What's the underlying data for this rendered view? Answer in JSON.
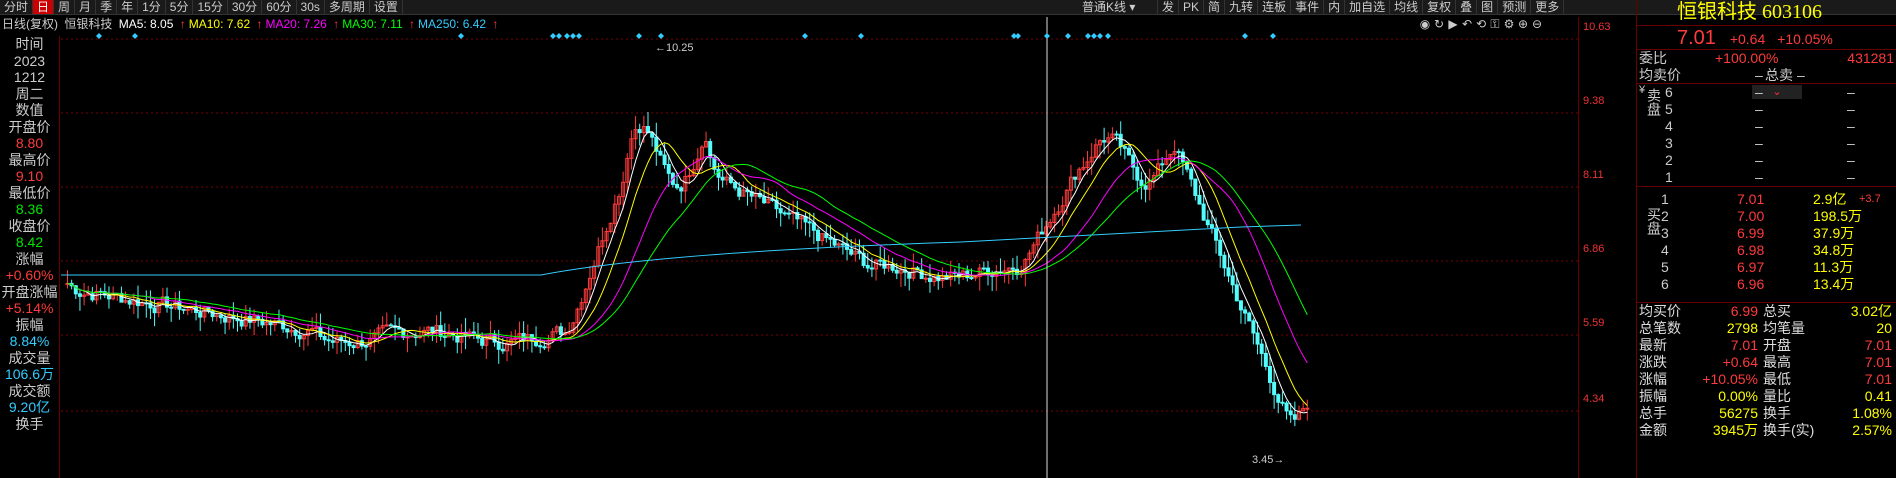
{
  "toolbar": {
    "left_items": [
      "分时",
      "日",
      "周",
      "月",
      "季",
      "年",
      "1分",
      "5分",
      "15分",
      "30分",
      "60分",
      "30s",
      "多周期",
      "设置"
    ],
    "active_index": 1,
    "kline_select": "普通K线",
    "right_items": [
      "发",
      "PK",
      "简",
      "九转",
      "连板",
      "事件",
      "内",
      "加自选",
      "均线",
      "复权",
      "叠",
      "图",
      "预测",
      "更多"
    ]
  },
  "ma_header": {
    "prefix": "日线(复权)",
    "stock": "恒银科技",
    "ma5": "MA5: 8.05",
    "ma10": "MA10: 7.62",
    "ma20": "MA20: 7.26",
    "ma30": "MA30: 7.11",
    "ma250": "MA250: 6.42"
  },
  "left_panel": [
    {
      "label": "时间",
      "value": "2023",
      "color": "#ccc"
    },
    {
      "label": "",
      "value": "1212",
      "color": "#ccc"
    },
    {
      "label": "",
      "value": "周二",
      "color": "#ccc"
    },
    {
      "label": "数值",
      "value": "",
      "color": "#ccc"
    },
    {
      "label": "开盘价",
      "value": "8.80",
      "color": "#ff3b3b"
    },
    {
      "label": "最高价",
      "value": "9.10",
      "color": "#ff3b3b"
    },
    {
      "label": "最低价",
      "value": "8.36",
      "color": "#00e600"
    },
    {
      "label": "收盘价",
      "value": "8.42",
      "color": "#00e600"
    },
    {
      "label": "涨幅",
      "value": "+0.60%",
      "color": "#ff3b3b"
    },
    {
      "label": "开盘涨幅",
      "value": "+5.14%",
      "color": "#ff3b3b"
    },
    {
      "label": "振幅",
      "value": "8.84%",
      "color": "#3cf"
    },
    {
      "label": "成交量",
      "value": "106.6万",
      "color": "#3cf"
    },
    {
      "label": "成交额",
      "value": "9.20亿",
      "color": "#3cf"
    },
    {
      "label": "换手",
      "value": "",
      "color": "#ccc"
    }
  ],
  "price_axis": [
    "10.63",
    "9.38",
    "8.11",
    "6.86",
    "5.59",
    "4.34"
  ],
  "annotations": {
    "high": "10.25",
    "low": "3.45"
  },
  "quote": {
    "name": "恒银科技",
    "code": "603106",
    "price": "7.01",
    "change": "+0.64",
    "change_pct": "+10.05%",
    "weibi_label": "委比",
    "weibi": "+100.00%",
    "weicha": "431281",
    "avg_sell_label": "均卖价",
    "total_sell_label": "总卖",
    "sell_side_label": "卖盘",
    "buy_side_label": "买盘",
    "sell_levels": [
      "6",
      "5",
      "4",
      "3",
      "2",
      "1"
    ],
    "sell_price": "–",
    "buy_levels": [
      {
        "lvl": "1",
        "price": "7.01",
        "vol": "2.9亿",
        "extra": "+3.7"
      },
      {
        "lvl": "2",
        "price": "7.00",
        "vol": "198.5万",
        "extra": ""
      },
      {
        "lvl": "3",
        "price": "6.99",
        "vol": "37.9万",
        "extra": ""
      },
      {
        "lvl": "4",
        "price": "6.98",
        "vol": "34.8万",
        "extra": ""
      },
      {
        "lvl": "5",
        "price": "6.97",
        "vol": "11.3万",
        "extra": ""
      },
      {
        "lvl": "6",
        "price": "6.96",
        "vol": "13.4万",
        "extra": ""
      }
    ],
    "stats": [
      {
        "l": "均买价",
        "v": "6.99",
        "l2": "总买",
        "v2": "3.02亿",
        "c": "#ff3b3b",
        "c2": "#ff0"
      },
      {
        "l": "总笔数",
        "v": "2798",
        "l2": "均笔量",
        "v2": "20",
        "c": "#ff0",
        "c2": "#ff0"
      },
      {
        "l": "最新",
        "v": "7.01",
        "l2": "开盘",
        "v2": "7.01",
        "c": "#ff3b3b",
        "c2": "#ff3b3b"
      },
      {
        "l": "涨跌",
        "v": "+0.64",
        "l2": "最高",
        "v2": "7.01",
        "c": "#ff3b3b",
        "c2": "#ff3b3b"
      },
      {
        "l": "涨幅",
        "v": "+10.05%",
        "l2": "最低",
        "v2": "7.01",
        "c": "#ff3b3b",
        "c2": "#ff3b3b"
      },
      {
        "l": "振幅",
        "v": "0.00%",
        "l2": "量比",
        "v2": "0.41",
        "c": "#ff0",
        "c2": "#ff0"
      },
      {
        "l": "总手",
        "v": "56275",
        "l2": "换手",
        "v2": "1.08%",
        "c": "#ff0",
        "c2": "#ff0"
      },
      {
        "l": "金额",
        "v": "3945万",
        "l2": "换手(实)",
        "v2": "2.57%",
        "c": "#ff0",
        "c2": "#ff0"
      }
    ]
  }
}
